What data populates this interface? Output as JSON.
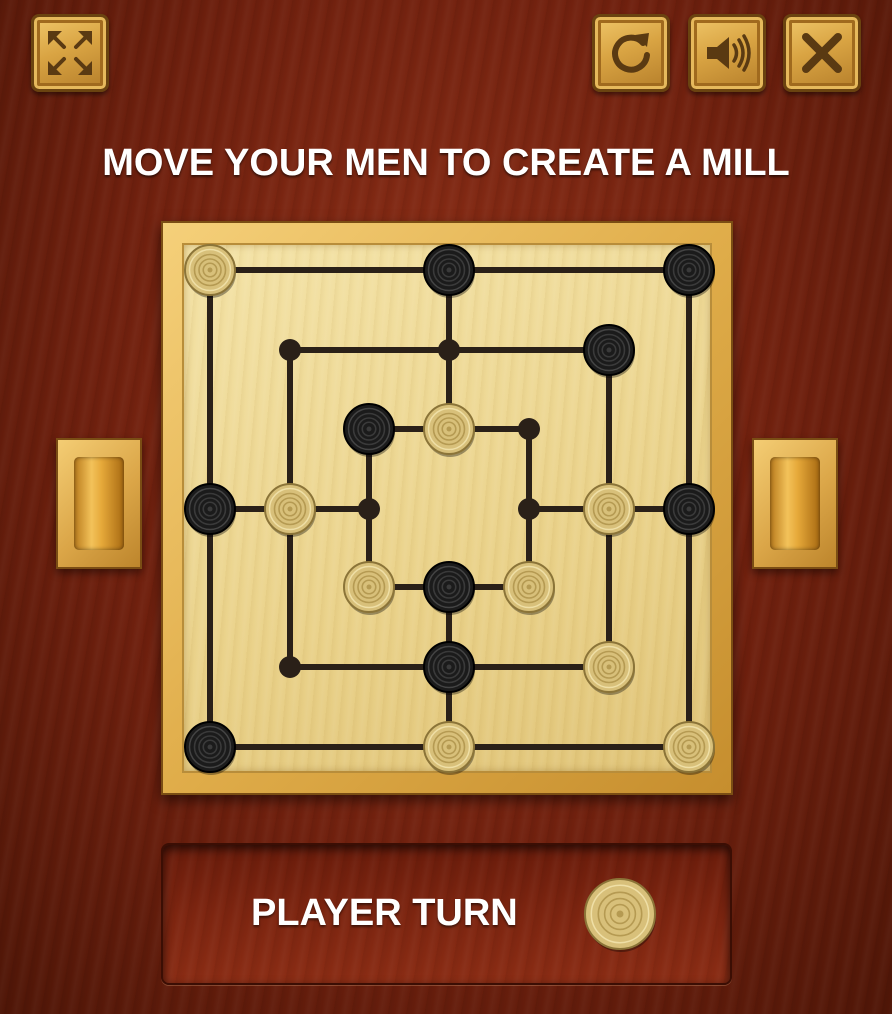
{
  "toolbar": {
    "fullscreen_icon": "expand-arrows-icon",
    "restart_icon": "restart-icon",
    "sound_icon": "speaker-icon",
    "close_icon": "close-x-icon"
  },
  "headline": "MOVE YOUR MEN TO CREATE A MILL",
  "status": {
    "text": "PLAYER TURN",
    "current_player": "light"
  },
  "colors": {
    "background": "#6f200e",
    "board_frame": "#e0ad4a",
    "board_surface": "#ead28a",
    "line": "#2a2018",
    "light_piece": "#d9c27a",
    "dark_piece": "#1c1c1c",
    "button": "#d9a443"
  },
  "board": {
    "pieces": [
      {
        "ring": "outer",
        "pos": "top-left",
        "color": "light"
      },
      {
        "ring": "outer",
        "pos": "top-mid",
        "color": "dark"
      },
      {
        "ring": "outer",
        "pos": "top-right",
        "color": "dark"
      },
      {
        "ring": "outer",
        "pos": "mid-left",
        "color": "dark"
      },
      {
        "ring": "outer",
        "pos": "mid-right",
        "color": "dark"
      },
      {
        "ring": "outer",
        "pos": "bottom-left",
        "color": "dark"
      },
      {
        "ring": "outer",
        "pos": "bottom-mid",
        "color": "light"
      },
      {
        "ring": "outer",
        "pos": "bottom-right",
        "color": "light"
      },
      {
        "ring": "middle",
        "pos": "top-left",
        "color": "empty"
      },
      {
        "ring": "middle",
        "pos": "top-mid",
        "color": "empty"
      },
      {
        "ring": "middle",
        "pos": "top-right",
        "color": "dark"
      },
      {
        "ring": "middle",
        "pos": "mid-left",
        "color": "light"
      },
      {
        "ring": "middle",
        "pos": "mid-right",
        "color": "light"
      },
      {
        "ring": "middle",
        "pos": "bottom-left",
        "color": "empty"
      },
      {
        "ring": "middle",
        "pos": "bottom-mid",
        "color": "dark"
      },
      {
        "ring": "middle",
        "pos": "bottom-right",
        "color": "light"
      },
      {
        "ring": "inner",
        "pos": "top-left",
        "color": "dark"
      },
      {
        "ring": "inner",
        "pos": "top-mid",
        "color": "light"
      },
      {
        "ring": "inner",
        "pos": "top-right",
        "color": "empty"
      },
      {
        "ring": "inner",
        "pos": "mid-left",
        "color": "empty"
      },
      {
        "ring": "inner",
        "pos": "mid-right",
        "color": "empty"
      },
      {
        "ring": "inner",
        "pos": "bottom-left",
        "color": "light"
      },
      {
        "ring": "inner",
        "pos": "bottom-mid",
        "color": "dark"
      },
      {
        "ring": "inner",
        "pos": "bottom-right",
        "color": "light"
      }
    ]
  }
}
